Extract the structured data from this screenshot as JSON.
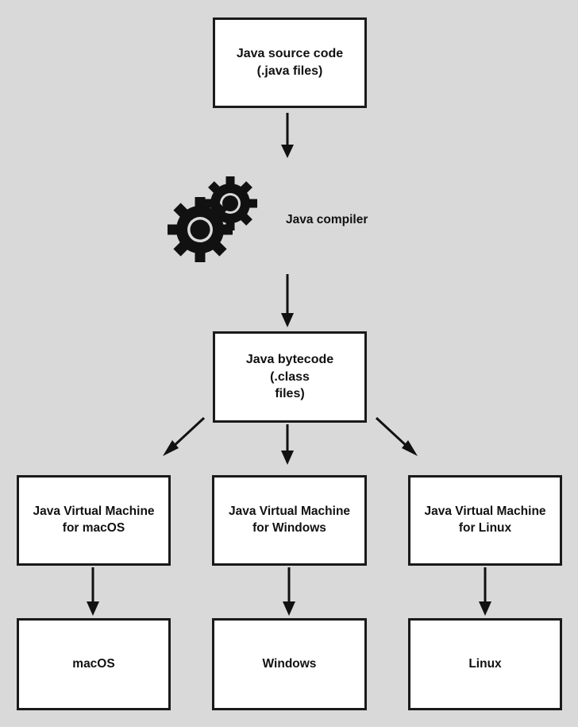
{
  "diagram": {
    "title": "Java platform independence flow",
    "background_color": "#d9d9d9",
    "box_fill_color": "#ffffff",
    "border_color": "#1a1a1a",
    "text_color": "#111111",
    "nodes": {
      "source": "Java source code\n(.java files)",
      "compiler_label": "Java compiler",
      "bytecode": "Java bytecode (.class\nfiles)",
      "jvm_macos": "Java Virtual Machine\nfor macOS",
      "jvm_windows": "Java Virtual Machine\nfor Windows",
      "jvm_linux": "Java Virtual Machine\nfor Linux",
      "os_macos": "macOS",
      "os_windows": "Windows",
      "os_linux": "Linux"
    },
    "icons": {
      "compiler": "gears-icon"
    },
    "edges": [
      {
        "from": "source",
        "to": "compiler_label",
        "style": "arrow-down"
      },
      {
        "from": "compiler_label",
        "to": "bytecode",
        "style": "arrow-down"
      },
      {
        "from": "bytecode",
        "to": "jvm_macos",
        "style": "arrow-diagonal-left"
      },
      {
        "from": "bytecode",
        "to": "jvm_windows",
        "style": "arrow-down"
      },
      {
        "from": "bytecode",
        "to": "jvm_linux",
        "style": "arrow-diagonal-right"
      },
      {
        "from": "jvm_macos",
        "to": "os_macos",
        "style": "arrow-down"
      },
      {
        "from": "jvm_windows",
        "to": "os_windows",
        "style": "arrow-down"
      },
      {
        "from": "jvm_linux",
        "to": "os_linux",
        "style": "arrow-down"
      }
    ]
  }
}
